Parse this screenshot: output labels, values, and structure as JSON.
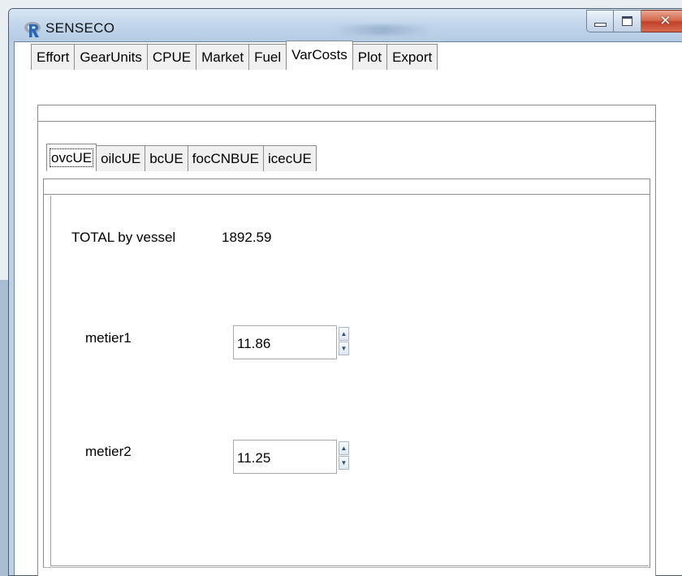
{
  "window": {
    "title": "SENSECO",
    "app_icon": "r-logo-icon",
    "controls": {
      "minimize": "minimize-icon",
      "maximize": "maximize-icon",
      "close": "close-icon"
    }
  },
  "tabs": [
    {
      "label": "Effort"
    },
    {
      "label": "GearUnits"
    },
    {
      "label": "CPUE"
    },
    {
      "label": "Market"
    },
    {
      "label": "Fuel"
    },
    {
      "label": "VarCosts",
      "active": true
    },
    {
      "label": "Plot"
    },
    {
      "label": "Export"
    }
  ],
  "subtabs": [
    {
      "label": "ovcUE",
      "active": true
    },
    {
      "label": "oilcUE"
    },
    {
      "label": "bcUE"
    },
    {
      "label": "focCNBUE"
    },
    {
      "label": "icecUE"
    }
  ],
  "panel": {
    "total_label": "TOTAL by vessel",
    "total_value": "1892.59",
    "metiers": [
      {
        "label": "metier1",
        "value": "11.86"
      },
      {
        "label": "metier2",
        "value": "11.25"
      }
    ]
  },
  "colors": {
    "title_bar": "#c3d7ec",
    "close_button": "#c1412a",
    "r_logo": "#2566b7"
  }
}
